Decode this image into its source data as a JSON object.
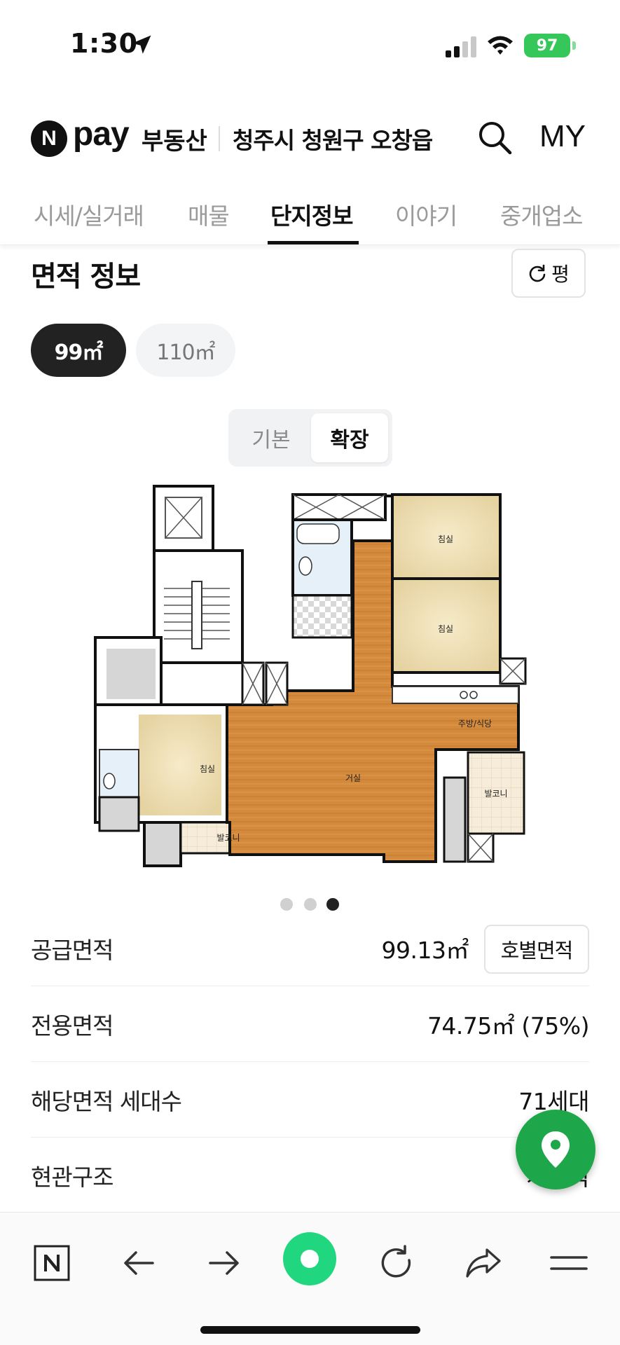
{
  "status_bar": {
    "time": "1:30",
    "battery": "97"
  },
  "header": {
    "logo_letter": "N",
    "logo_pay": "pay",
    "logo_service": "부동산",
    "region": "청주시 청원구 오창읍",
    "my_label": "MY"
  },
  "tabs": [
    {
      "label": "시세/실거래"
    },
    {
      "label": "매물"
    },
    {
      "label": "단지정보",
      "active": true
    },
    {
      "label": "이야기"
    },
    {
      "label": "중개업소"
    }
  ],
  "area_section": {
    "title": "면적 정보",
    "unit_toggle_label": "평",
    "area_chips": [
      {
        "label": "99㎡",
        "selected": true
      },
      {
        "label": "110㎡",
        "selected": false
      }
    ],
    "plan_mode": {
      "options": [
        "기본",
        "확장"
      ],
      "selected": "확장"
    },
    "floorplan_labels": {
      "bedroom": "침실",
      "living": "거실",
      "kitchen": "주방/식당",
      "balcony": "발코니"
    },
    "carousel": {
      "total": 3,
      "current": 3
    },
    "rows": [
      {
        "label": "공급면적",
        "value": "99.13㎡",
        "button": "호별면적"
      },
      {
        "label": "전용면적",
        "value": "74.75㎡ (75%)"
      },
      {
        "label": "해당면적 세대수",
        "value": "71세대"
      },
      {
        "label": "현관구조",
        "value": "계단식"
      }
    ]
  },
  "colors": {
    "accent_green": "#1ea64a",
    "active_tab": "#111111",
    "battery_green": "#35c759"
  },
  "icons": {
    "status": [
      "location-arrow-icon",
      "signal-icon",
      "wifi-icon",
      "battery-icon"
    ],
    "header": [
      "naver-n-icon",
      "search-icon"
    ],
    "fab": "map-pin-icon",
    "bottom_bar": [
      "naver-home-icon",
      "back-arrow-icon",
      "forward-arrow-icon",
      "green-dot-icon",
      "refresh-icon",
      "share-icon",
      "menu-icon"
    ]
  }
}
